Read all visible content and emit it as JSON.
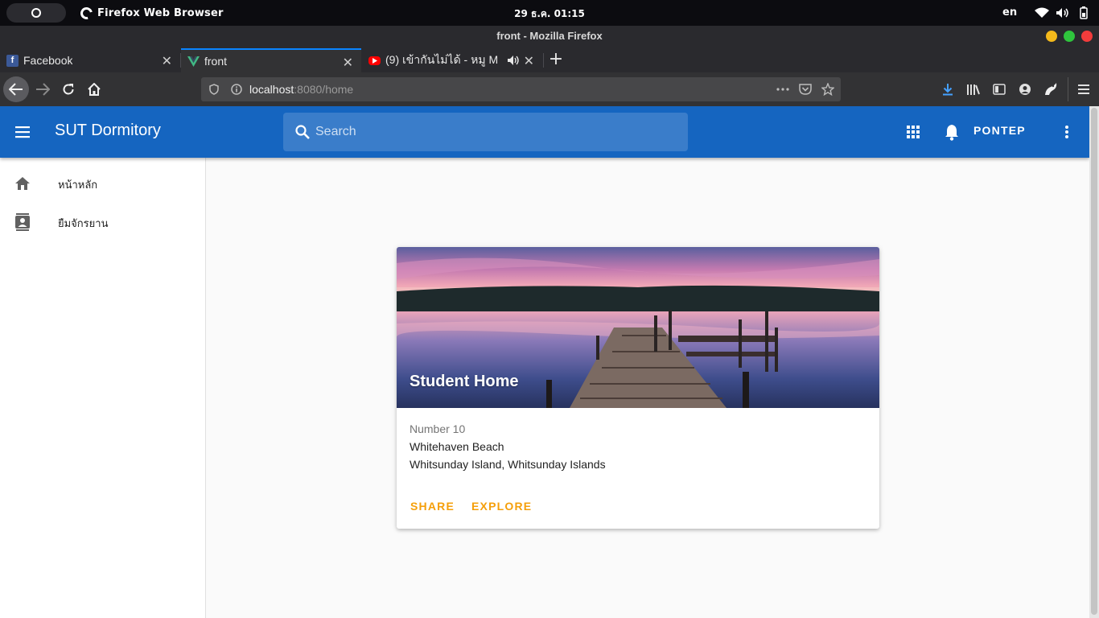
{
  "os": {
    "app_name": "Firefox Web Browser",
    "clock": "29 ธ.ค.  01:15",
    "lang": "en"
  },
  "browser": {
    "window_title": "front - Mozilla Firefox",
    "tabs": [
      {
        "label": "Facebook",
        "favicon": "facebook-icon"
      },
      {
        "label": "front",
        "favicon": "vue-icon",
        "active": true
      },
      {
        "label": "(9) เข้ากันไม่ได้ - หมู M",
        "favicon": "youtube-icon"
      }
    ],
    "url_host": "localhost",
    "url_rest": ":8080/home"
  },
  "app": {
    "title": "SUT Dormitory",
    "search_placeholder": "Search",
    "user": "PONTEP",
    "brand_color": "#1565c0",
    "accent_color": "#f59f0a"
  },
  "drawer": {
    "items": [
      {
        "label": "หน้าหลัก",
        "icon": "home-icon"
      },
      {
        "label": "ยืมจักรยาน",
        "icon": "contact-card-icon"
      }
    ]
  },
  "card": {
    "title": "Student Home",
    "subtitle": "Number 10",
    "line1": "Whitehaven Beach",
    "line2": "Whitsunday Island, Whitsunday Islands",
    "share": "SHARE",
    "explore": "EXPLORE"
  }
}
